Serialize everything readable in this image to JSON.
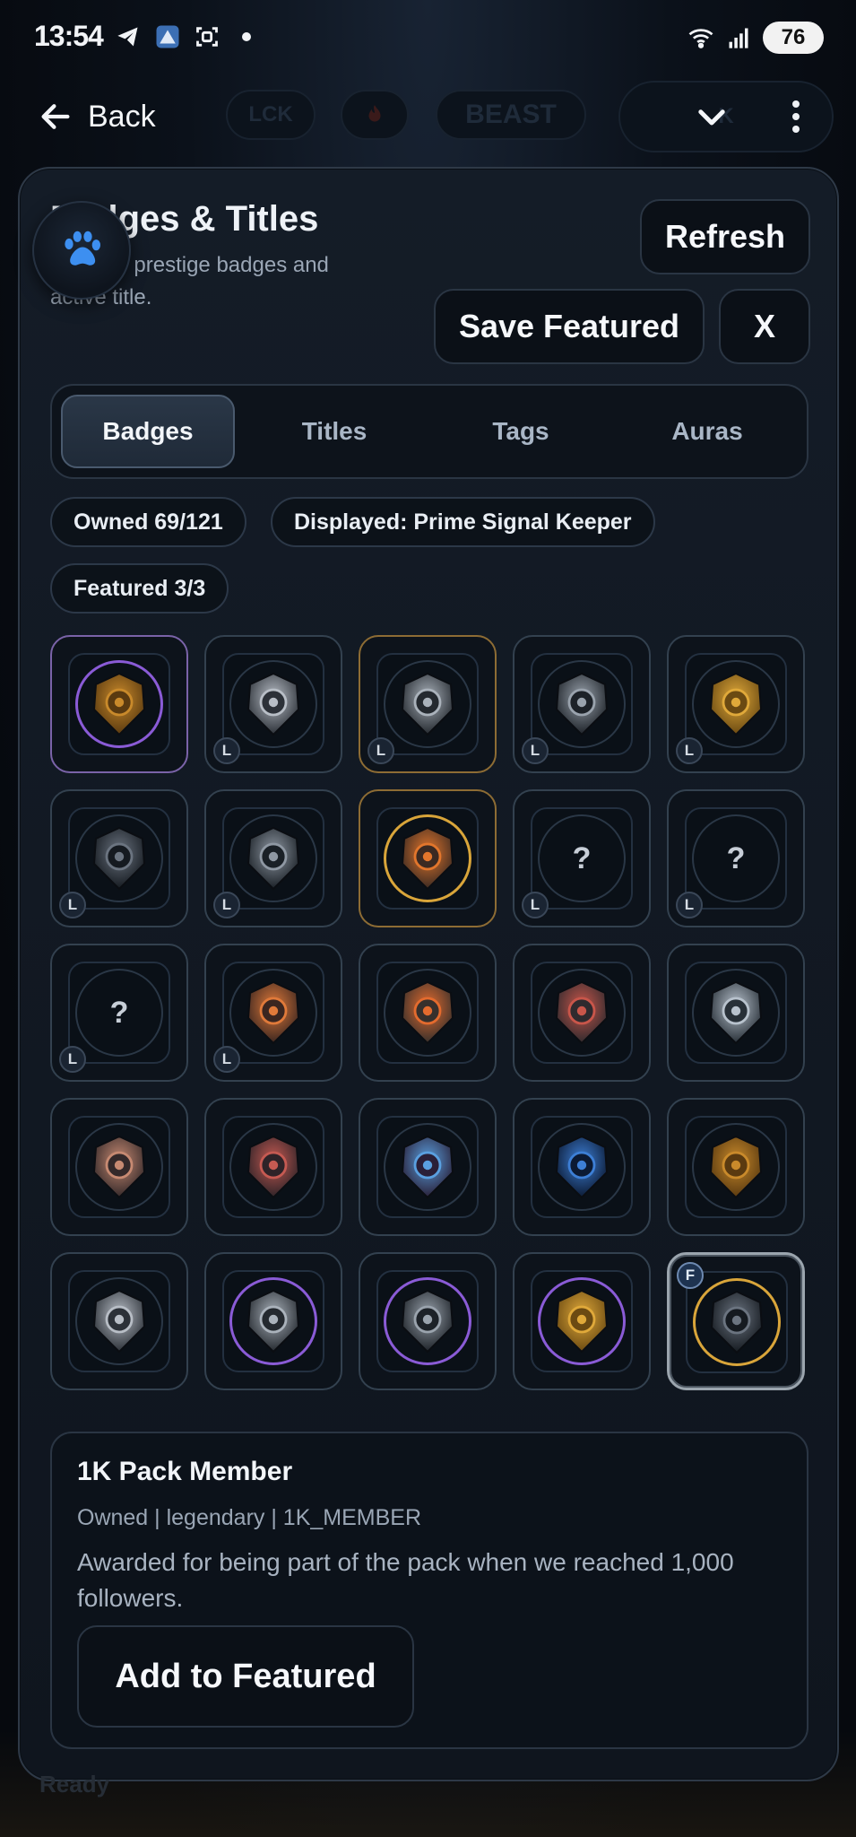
{
  "status_bar": {
    "time": "13:54",
    "battery": "76",
    "icons": [
      "telegram-icon",
      "app-icon",
      "screenshot-icon",
      "dot-icon",
      "wifi-icon",
      "signal-icon"
    ]
  },
  "appbar": {
    "back_label": "Back",
    "background_chips": [
      "LCK",
      "",
      "BEAST",
      "K"
    ]
  },
  "panel": {
    "title": "Badges & Titles",
    "subtitle": "Manage prestige badges and active title.",
    "refresh_label": "Refresh",
    "save_featured_label": "Save Featured",
    "close_label": "X",
    "tabs": [
      {
        "label": "Badges",
        "active": true
      },
      {
        "label": "Titles",
        "active": false
      },
      {
        "label": "Tags",
        "active": false
      },
      {
        "label": "Auras",
        "active": false
      }
    ],
    "stats": {
      "owned": "Owned 69/121",
      "displayed": "Displayed: Prime Signal Keeper",
      "featured": "Featured 3/3"
    }
  },
  "badges": [
    {
      "icon": "gold-bars-badge-icon",
      "tag": "",
      "ring": "purple",
      "frame": "purple"
    },
    {
      "icon": "flaming-dice-badge-icon",
      "tag": "L",
      "ring": "",
      "frame": ""
    },
    {
      "icon": "dice-emblem-badge-icon",
      "tag": "L",
      "ring": "",
      "frame": "gold"
    },
    {
      "icon": "infinity-dice-badge-icon",
      "tag": "L",
      "ring": "",
      "frame": ""
    },
    {
      "icon": "infinity-dice-badge-icon",
      "tag": "L",
      "ring": "",
      "frame": ""
    },
    {
      "icon": "infinity-dice-badge-icon",
      "tag": "L",
      "ring": "",
      "frame": ""
    },
    {
      "icon": "infinity-dice-badge-icon",
      "tag": "L",
      "ring": "",
      "frame": ""
    },
    {
      "icon": "reset-pioneer-badge-icon",
      "tag": "",
      "ring": "gold",
      "frame": "gold"
    },
    {
      "icon": "locked-badge-icon",
      "tag": "L",
      "ring": "",
      "frame": "",
      "locked": "?"
    },
    {
      "icon": "locked-badge-icon",
      "tag": "L",
      "ring": "",
      "frame": "",
      "locked": "?"
    },
    {
      "icon": "locked-badge-icon",
      "tag": "L",
      "ring": "",
      "frame": "",
      "locked": "?"
    },
    {
      "icon": "dark-skull-badge-icon",
      "tag": "L",
      "ring": "",
      "frame": ""
    },
    {
      "icon": "crowned-skull-badge-icon",
      "tag": "",
      "ring": "",
      "frame": ""
    },
    {
      "icon": "map-pin-shield-badge-icon",
      "tag": "",
      "ring": "",
      "frame": ""
    },
    {
      "icon": "compass-shield-badge-icon",
      "tag": "",
      "ring": "",
      "frame": ""
    },
    {
      "icon": "dragon-shield-badge-icon",
      "tag": "",
      "ring": "",
      "frame": ""
    },
    {
      "icon": "fortress-badge-icon",
      "tag": "",
      "ring": "",
      "frame": ""
    },
    {
      "icon": "orange-pin-badge-icon",
      "tag": "",
      "ring": "",
      "frame": ""
    },
    {
      "icon": "pin-crest-badge-icon",
      "tag": "",
      "ring": "",
      "frame": ""
    },
    {
      "icon": "red-orb-shield-badge-icon",
      "tag": "",
      "ring": "",
      "frame": ""
    },
    {
      "icon": "steel-shield-badge-icon",
      "tag": "",
      "ring": "",
      "frame": ""
    },
    {
      "icon": "ember-crest-badge-icon",
      "tag": "",
      "ring": "purple",
      "frame": ""
    },
    {
      "icon": "crimson-crest-badge-icon",
      "tag": "",
      "ring": "purple",
      "frame": ""
    },
    {
      "icon": "cosmic-crest-badge-icon",
      "tag": "",
      "ring": "purple",
      "frame": ""
    },
    {
      "icon": "howling-wolf-badge-icon",
      "tag": "F",
      "ring": "gold",
      "frame": "selected"
    }
  ],
  "detail": {
    "name": "1K Pack Member",
    "meta": "Owned | legendary | 1K_MEMBER",
    "description": "Awarded for being part of the pack when we reached 1,000 followers.",
    "action_label": "Add to Featured"
  },
  "footer_status": "Ready",
  "colors": {
    "accent_gold": "#d9a53a",
    "accent_purple": "#8a5bd6",
    "panel_border": "#2e3947"
  }
}
